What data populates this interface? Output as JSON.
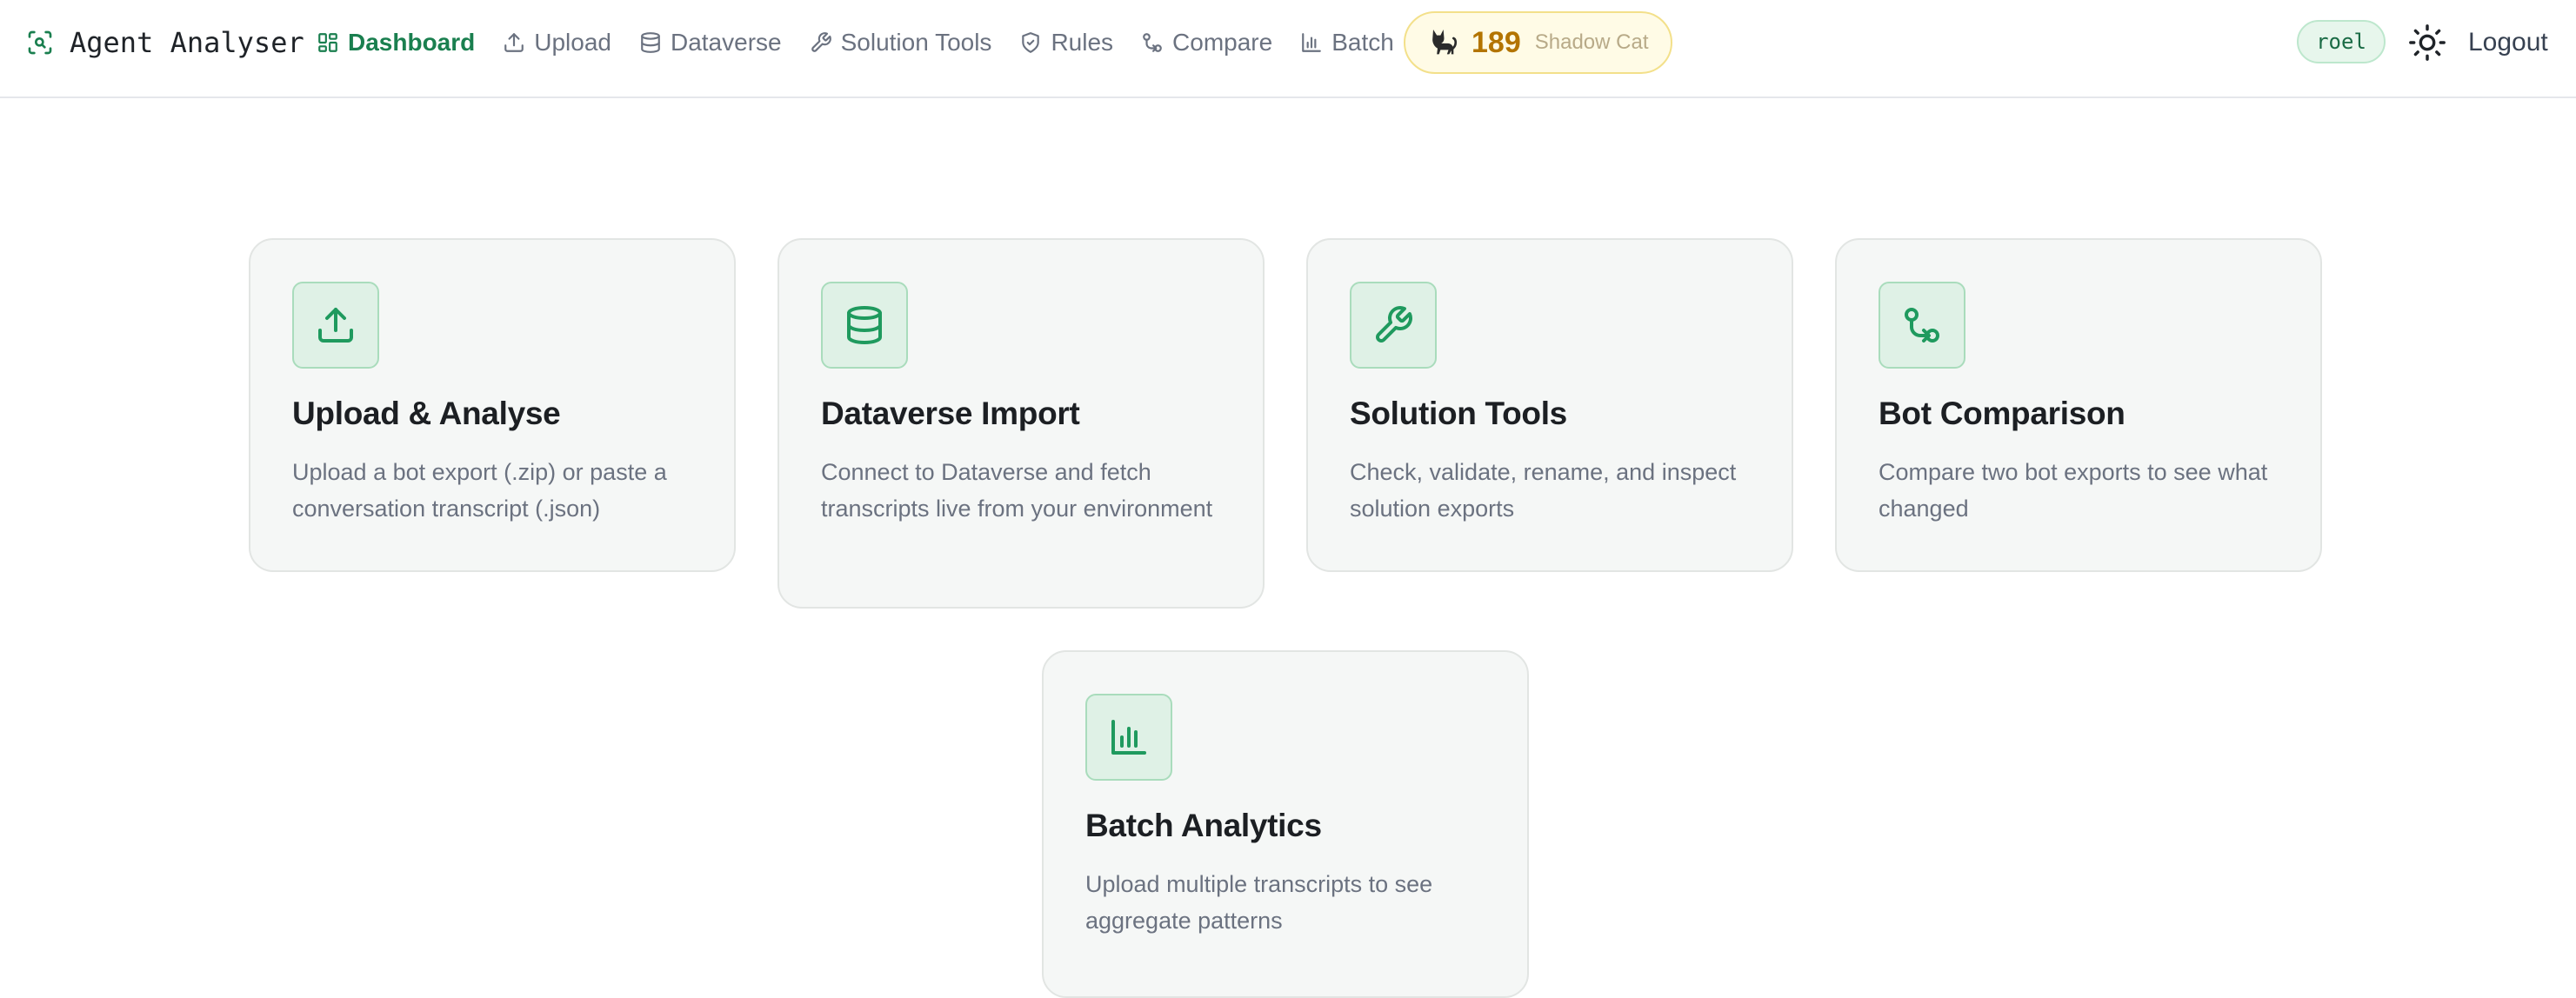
{
  "app": {
    "title": "Agent Analyser"
  },
  "nav": {
    "items": [
      {
        "label": "Dashboard",
        "icon": "dashboard-icon",
        "active": true
      },
      {
        "label": "Upload",
        "icon": "upload-icon"
      },
      {
        "label": "Dataverse",
        "icon": "database-icon"
      },
      {
        "label": "Solution Tools",
        "icon": "wrench-icon"
      },
      {
        "label": "Rules",
        "icon": "shield-icon"
      },
      {
        "label": "Compare",
        "icon": "git-compare-icon"
      },
      {
        "label": "Batch",
        "icon": "bar-chart-icon"
      }
    ]
  },
  "streak": {
    "count": "189",
    "title": "Shadow Cat",
    "icon": "cat-icon"
  },
  "user": {
    "name": "roel"
  },
  "theme_toggle": {
    "icon": "sun-icon"
  },
  "logout": {
    "label": "Logout"
  },
  "colors": {
    "accent": "#1a7f4f",
    "card_bg": "#f5f7f6",
    "icon_bg": "#dff1e6",
    "streak_bg": "#fffbe6"
  },
  "cards": [
    {
      "title": "Upload & Analyse",
      "description": "Upload a bot export (.zip) or paste a conversation transcript (.json)",
      "icon": "upload-icon"
    },
    {
      "title": "Dataverse Import",
      "description": "Connect to Dataverse and fetch transcripts live from your environment",
      "icon": "database-icon"
    },
    {
      "title": "Solution Tools",
      "description": "Check, validate, rename, and inspect solution exports",
      "icon": "wrench-icon"
    },
    {
      "title": "Bot Comparison",
      "description": "Compare two bot exports to see what changed",
      "icon": "git-compare-icon"
    },
    {
      "title": "Batch Analytics",
      "description": "Upload multiple transcripts to see aggregate patterns",
      "icon": "bar-chart-icon"
    }
  ]
}
